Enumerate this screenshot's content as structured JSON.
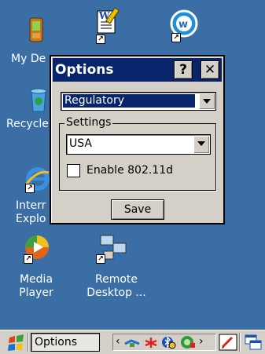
{
  "desktop": {
    "icons": [
      {
        "label": "My De",
        "name": "my-device-icon"
      },
      {
        "label": "",
        "name": "wordpad-icon"
      },
      {
        "label": "",
        "name": "wifi-app-icon"
      },
      {
        "label": "Recycle",
        "name": "recycle-bin-icon"
      },
      {
        "label": "Interr",
        "label2": "Explo",
        "name": "internet-explorer-icon"
      },
      {
        "label": "Media",
        "label2": "Player",
        "name": "media-player-icon"
      },
      {
        "label": "Remote",
        "label2": "Desktop ...",
        "name": "remote-desktop-icon"
      }
    ]
  },
  "dialog": {
    "title": "Options",
    "help_label": "?",
    "close_label": "✕",
    "category_value": "Regulatory",
    "group_label": "Settings",
    "country_value": "USA",
    "checkbox_label": "Enable 802.11d",
    "checkbox_checked": false,
    "save_label": "Save"
  },
  "taskbar": {
    "task_label": "Options",
    "colors": {
      "taskbar": "#d4d0c8",
      "desktop": "#3a6ea5",
      "titlebar": "#08246b"
    }
  }
}
